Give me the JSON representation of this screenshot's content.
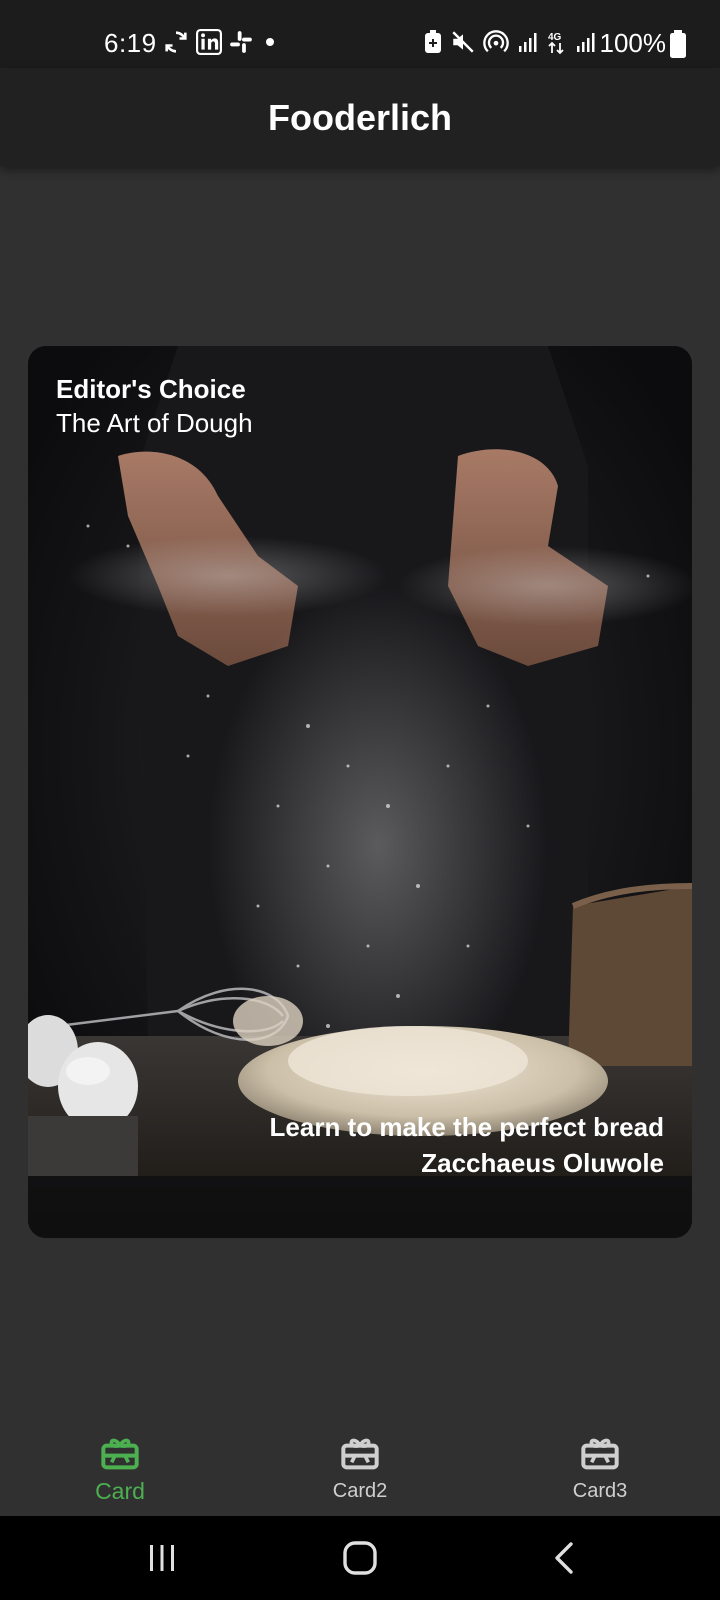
{
  "status_bar": {
    "time": "6:19",
    "battery": "100%",
    "left_icons": [
      "sync-icon",
      "linkedin-icon",
      "slack-icon",
      "notification-dot-icon"
    ],
    "right_icons": [
      "battery-saver-icon",
      "mute-icon",
      "hotspot-icon",
      "signal-icon",
      "4g-icon",
      "signal-icon",
      "battery-icon"
    ]
  },
  "app_bar": {
    "title": "Fooderlich"
  },
  "card": {
    "kicker": "Editor's Choice",
    "title": "The Art of Dough",
    "description": "Learn to make the perfect bread",
    "author": "Zacchaeus Oluwole",
    "image": "flour-dusting-hands-photo"
  },
  "bottom_nav": {
    "items": [
      {
        "label": "Card",
        "icon": "card-giftcard-icon",
        "active": true
      },
      {
        "label": "Card2",
        "icon": "card-giftcard-icon",
        "active": false
      },
      {
        "label": "Card3",
        "icon": "card-giftcard-icon",
        "active": false
      }
    ],
    "active_color": "#4caf50",
    "inactive_color": "#cfcfcf"
  },
  "system_nav": {
    "buttons": [
      "recents-icon",
      "home-icon",
      "back-icon"
    ]
  },
  "colors": {
    "background": "#303030",
    "app_bar": "#212121",
    "status_bar": "#1c1c1c"
  }
}
